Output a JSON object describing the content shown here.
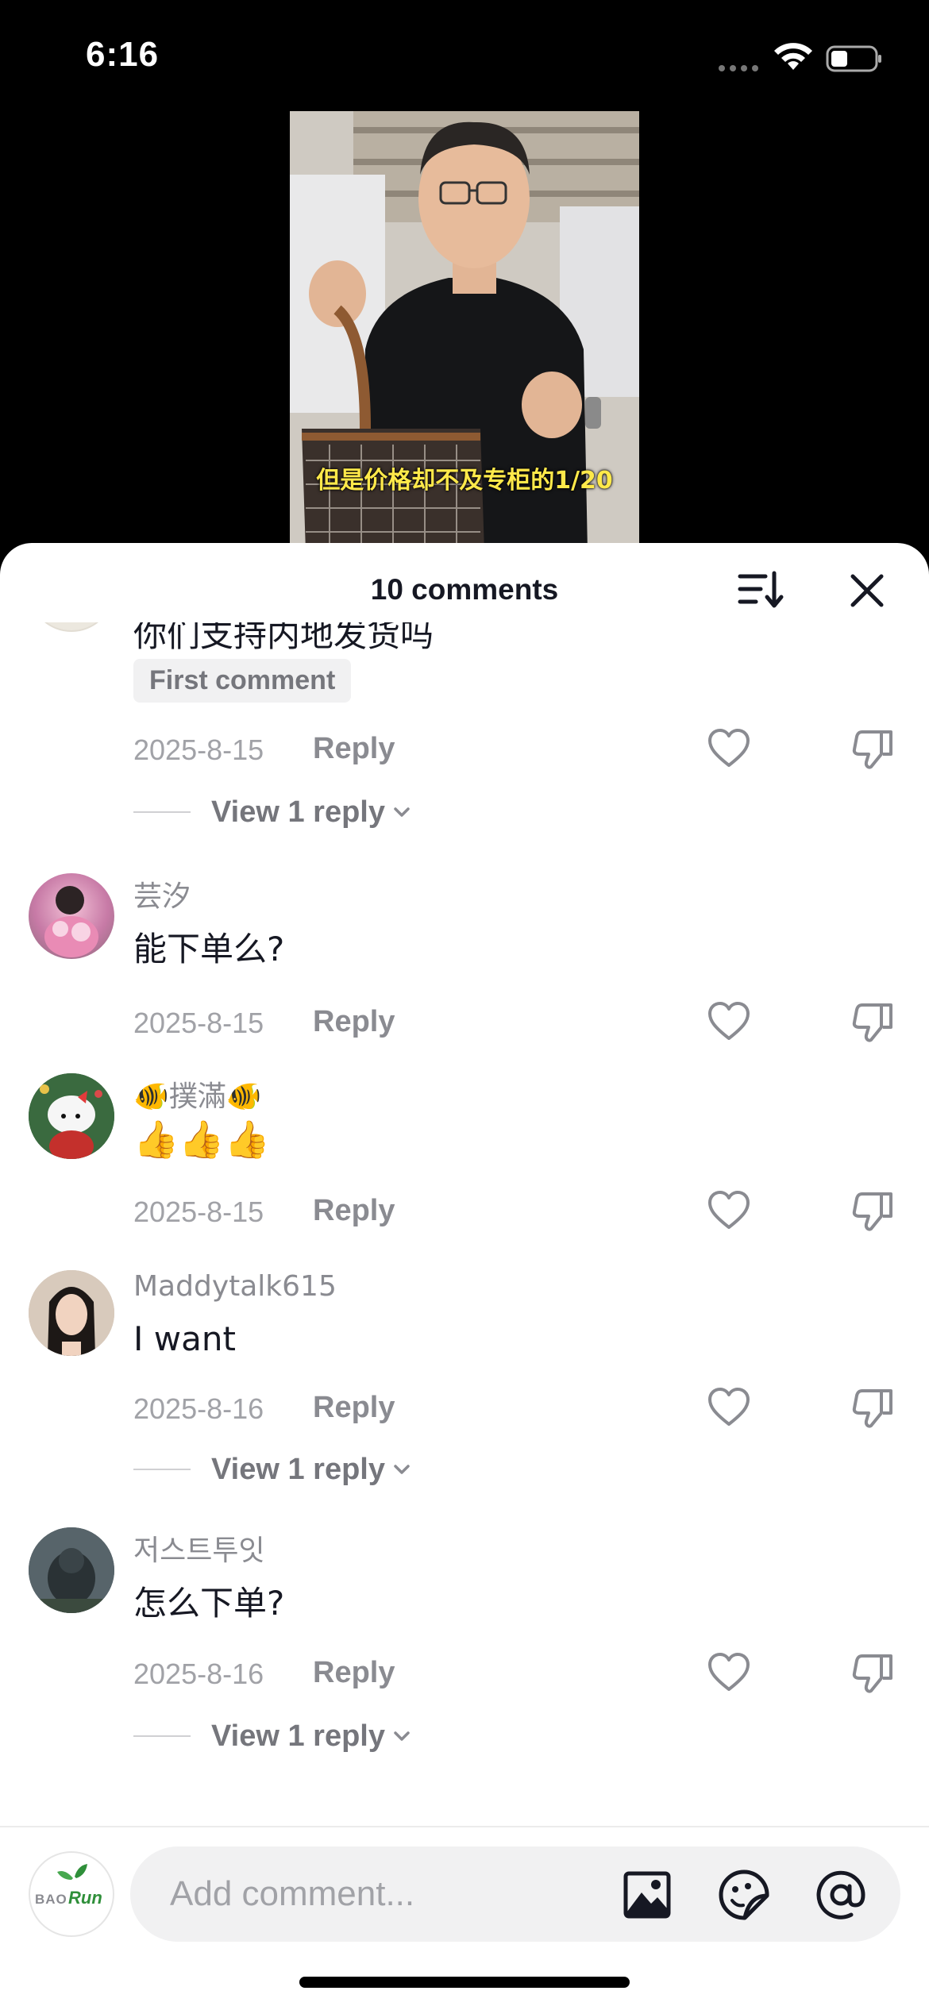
{
  "status_bar": {
    "time": "6:16"
  },
  "video": {
    "caption": "但是价格却不及专柜的1/20"
  },
  "sheet": {
    "title": "10 comments"
  },
  "comments": [
    {
      "text": "你们支持内地发货吗",
      "badge": "First comment",
      "date": "2025-8-15",
      "reply_label": "Reply",
      "view_replies": "View 1 reply"
    },
    {
      "username": "芸汐",
      "text": "能下单么?",
      "date": "2025-8-15",
      "reply_label": "Reply"
    },
    {
      "username": "🐠撲滿🐠",
      "text": "👍👍👍",
      "date": "2025-8-15",
      "reply_label": "Reply"
    },
    {
      "username": "Maddytalk615",
      "text": "I want",
      "date": "2025-8-16",
      "reply_label": "Reply",
      "view_replies": "View 1 reply"
    },
    {
      "username": "저스트투잇",
      "text": "怎么下单?",
      "date": "2025-8-16",
      "reply_label": "Reply",
      "view_replies": "View 1 reply"
    }
  ],
  "input": {
    "placeholder": "Add comment...",
    "avatar_text": "BAORUN"
  },
  "colors": {
    "text_primary": "#161823",
    "text_secondary": "#8a8b91",
    "caption": "#ffe94a",
    "logo_green": "#2f8f3a"
  }
}
